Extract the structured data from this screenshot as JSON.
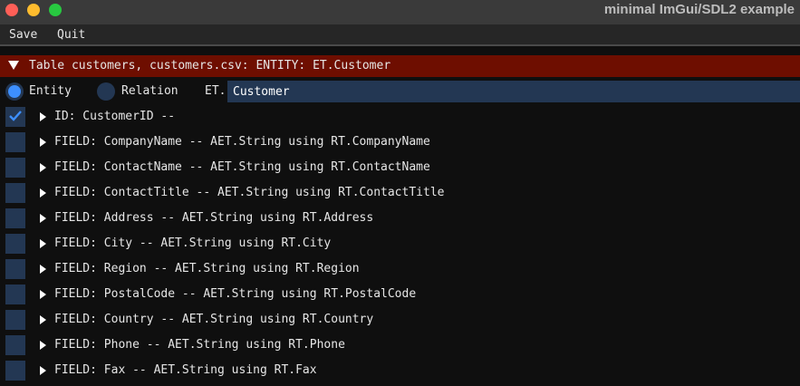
{
  "window": {
    "title": "minimal ImGui/SDL2 example"
  },
  "menu": {
    "save_label": "Save",
    "quit_label": "Quit"
  },
  "table_header": {
    "text": "Table customers, customers.csv: ENTITY: ET.Customer",
    "color": "#6e0e00"
  },
  "type_selector": {
    "entity_label": "Entity",
    "relation_label": "Relation",
    "selected": "Entity",
    "et_prefix": "ET.",
    "et_value": "Customer"
  },
  "fields": [
    {
      "text": "ID: CustomerID --",
      "checked": true
    },
    {
      "text": "FIELD: CompanyName -- AET.String using RT.CompanyName",
      "checked": false
    },
    {
      "text": "FIELD: ContactName -- AET.String using RT.ContactName",
      "checked": false
    },
    {
      "text": "FIELD: ContactTitle -- AET.String using RT.ContactTitle",
      "checked": false
    },
    {
      "text": "FIELD: Address -- AET.String using RT.Address",
      "checked": false
    },
    {
      "text": "FIELD: City -- AET.String using RT.City",
      "checked": false
    },
    {
      "text": "FIELD: Region -- AET.String using RT.Region",
      "checked": false
    },
    {
      "text": "FIELD: PostalCode -- AET.String using RT.PostalCode",
      "checked": false
    },
    {
      "text": "FIELD: Country -- AET.String using RT.Country",
      "checked": false
    },
    {
      "text": "FIELD: Phone -- AET.String using RT.Phone",
      "checked": false
    },
    {
      "text": "FIELD: Fax -- AET.String using RT.Fax",
      "checked": false
    }
  ],
  "colors": {
    "accent": "#3d8fff",
    "frame": "#233753"
  }
}
